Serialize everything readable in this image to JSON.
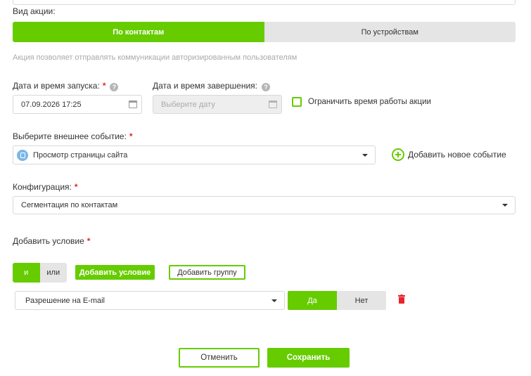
{
  "action_type": {
    "label": "Вид акции:",
    "options": [
      "По контактам",
      "По устройствам"
    ],
    "selected": "По контактам",
    "hint": "Акция позволяет отправлять коммуникации авторизированным пользователям"
  },
  "start": {
    "label": "Дата и время запуска:",
    "required": "*",
    "value": "07.09.2026 17:25"
  },
  "end": {
    "label": "Дата и время завершения:",
    "placeholder": "Выберите дату"
  },
  "limit_checkbox_label": "Ограничить время работы акции",
  "event": {
    "label": "Выберите внешнее событие:",
    "required": "*",
    "value": "Просмотр страницы сайта",
    "add_label": "Добавить новое событие"
  },
  "config": {
    "label": "Конфигурация:",
    "required": "*",
    "value": "Сегментация по контактам"
  },
  "condition": {
    "label": "Добавить условие",
    "required": "*",
    "logic_and": "и",
    "logic_or": "или",
    "add_condition": "Добавить условие",
    "add_group": "Добавить группу",
    "field_value": "Разрешение на E-mail",
    "yes": "Да",
    "no": "Нет"
  },
  "footer": {
    "cancel": "Отменить",
    "save": "Сохранить"
  },
  "colors": {
    "accent": "#66cc00",
    "required": "#e8232a",
    "delete": "#e8232a",
    "muted": "#aaaaaa"
  }
}
